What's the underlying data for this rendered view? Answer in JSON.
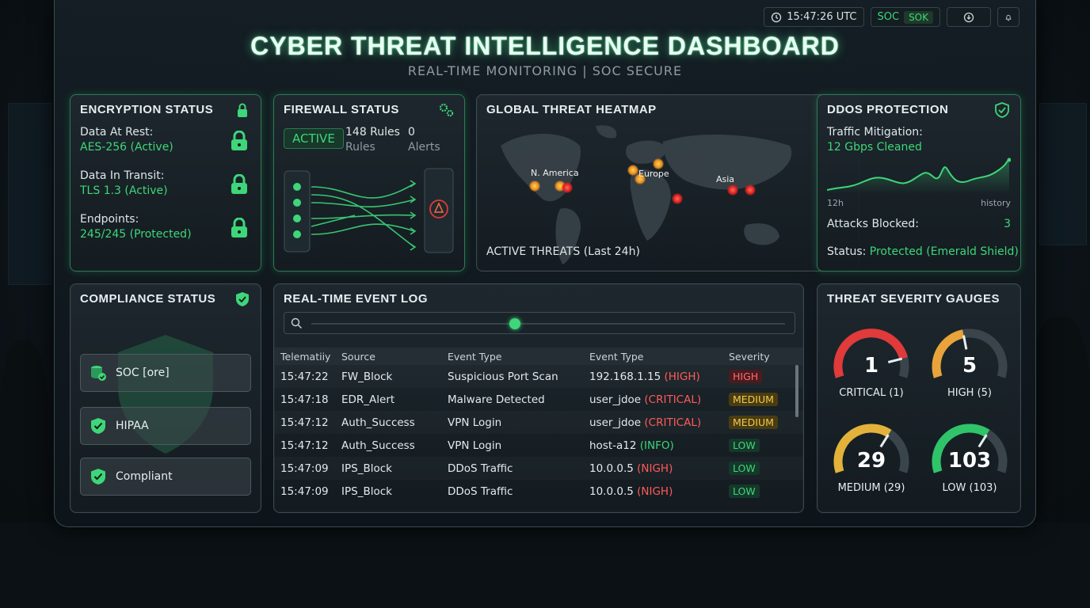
{
  "topbar": {
    "time": "15:47:26 UTC",
    "soc1": "SOC",
    "soc2": "SOK"
  },
  "header": {
    "title": "CYBER THREAT INTELLIGENCE DASHBOARD",
    "subtitle": "REAL-TIME MONITORING | SOC SECURE"
  },
  "encryption": {
    "title": "ENCRYPTION STATUS",
    "rows": [
      {
        "label": "Data At Rest:",
        "value": "AES-256 (Active)"
      },
      {
        "label": "Data In Transit:",
        "value": "TLS 1.3 (Active)"
      },
      {
        "label": "Endpoints:",
        "value": "245/245 (Protected)"
      }
    ]
  },
  "firewall": {
    "title": "FIREWALL STATUS",
    "state": "ACTIVE",
    "rules_value": "148 Rules",
    "rules_label": "Rules",
    "alerts_value": "0",
    "alerts_label": "Alerts"
  },
  "heatmap": {
    "title": "GLOBAL THREAT HEATMAP",
    "regions": [
      "N. America",
      "Europe",
      "Asia"
    ],
    "footer": "ACTIVE THREATS (Last 24h)"
  },
  "ddos": {
    "title": "DDOS PROTECTION",
    "mitigation_label": "Traffic Mitigation:",
    "mitigation_value": "12 Gbps Cleaned",
    "spark_left": "12h",
    "spark_right": "history",
    "attacks_label": "Attacks Blocked:",
    "attacks_value": "3",
    "status_label": "Status:",
    "status_value": "Protected (Emerald Shield)"
  },
  "compliance": {
    "title": "COMPLIANCE STATUS",
    "items": [
      "SOC [ore]",
      "HIPAA",
      "Compliant"
    ]
  },
  "eventlog": {
    "title": "REAL-TIME EVENT LOG",
    "slider_level": 0.43,
    "columns": [
      "Telematiiy",
      "Source",
      "Event Type",
      "Event Type",
      "Severity"
    ],
    "rows": [
      {
        "time": "15:47:22",
        "source": "FW_Block",
        "event": "Suspicious Port Scan",
        "target": "192.168.1.15",
        "tag": "(HIGH)",
        "tagclass": "HIGH",
        "severity": "HIGH"
      },
      {
        "time": "15:47:18",
        "source": "EDR_Alert",
        "event": "Malware Detected",
        "target": "user_jdoe",
        "tag": "(CRITICAL)",
        "tagclass": "CRITICAL",
        "severity": "MEDIUM"
      },
      {
        "time": "15:47:12",
        "source": "Auth_Success",
        "event": "VPN Login",
        "target": "user_jdoe",
        "tag": "(CRITICAL)",
        "tagclass": "CRITICAL",
        "severity": "MEDIUM"
      },
      {
        "time": "15:47:12",
        "source": "Auth_Success",
        "event": "VPN Login",
        "target": "host-a12",
        "tag": "(INFO)",
        "tagclass": "INFO",
        "severity": "LOW"
      },
      {
        "time": "15:47:09",
        "source": "IPS_Block",
        "event": "DDoS Traffic",
        "target": "10.0.0.5",
        "tag": "(NIGH)",
        "tagclass": "NIGH",
        "severity": "LOW"
      },
      {
        "time": "15:47:09",
        "source": "IPS_Block",
        "event": "DDoS Traffic",
        "target": "10.0.0.5",
        "tag": "(NIGH)",
        "tagclass": "NIGH",
        "severity": "LOW"
      }
    ]
  },
  "gauges": {
    "title": "THREAT SEVERITY GAUGES",
    "items": [
      {
        "value": "1",
        "label": "CRITICAL (1)",
        "color": "#e03a3a",
        "level": 0.85
      },
      {
        "value": "5",
        "label": "HIGH (5)",
        "color": "#e8a33a",
        "level": 0.45
      },
      {
        "value": "29",
        "label": "MEDIUM (29)",
        "color": "#e2b23a",
        "level": 0.65
      },
      {
        "value": "103",
        "label": "LOW (103)",
        "color": "#2fc46a",
        "level": 0.65
      }
    ]
  },
  "colors": {
    "accent": "#3ed67a",
    "danger": "#ff5a5a",
    "warning": "#f2c94c"
  }
}
